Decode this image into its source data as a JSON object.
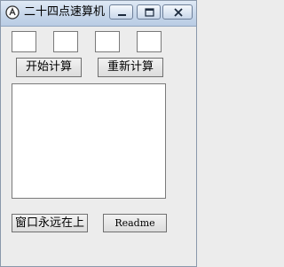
{
  "window": {
    "title": "二十四点速算机"
  },
  "titlebar": {
    "app_icon": "app-logo-icon",
    "minimize_icon": "minimize-icon",
    "maximize_icon": "maximize-icon",
    "close_icon": "close-icon"
  },
  "inputs": [
    {
      "value": ""
    },
    {
      "value": ""
    },
    {
      "value": ""
    },
    {
      "value": ""
    }
  ],
  "buttons": {
    "start": "开始计算",
    "recalc": "重新计算",
    "always_on_top": "窗口永远在上",
    "readme": "Readme"
  },
  "result": {
    "text": ""
  }
}
